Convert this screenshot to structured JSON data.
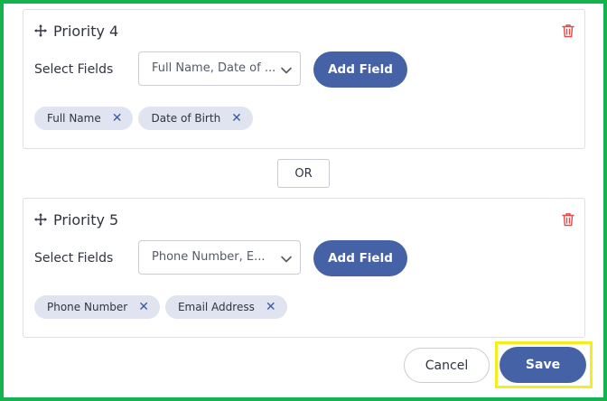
{
  "cards": [
    {
      "title": "Priority 4",
      "select_label": "Select Fields",
      "dropdown_value": "Full Name, Date of ...",
      "add_button": "Add Field",
      "chips": [
        "Full Name",
        "Date of Birth"
      ]
    },
    {
      "title": "Priority 5",
      "select_label": "Select Fields",
      "dropdown_value": "Phone Number, E...",
      "add_button": "Add Field",
      "chips": [
        "Phone Number",
        "Email Address"
      ]
    }
  ],
  "or_label": "OR",
  "footer": {
    "cancel_label": "Cancel",
    "save_label": "Save"
  },
  "colors": {
    "accent": "#4562a6",
    "chip_bg": "#dfe4f0",
    "delete": "#e04a4a",
    "frame": "#14b350",
    "highlight": "#f4ee1d"
  },
  "icons": {
    "drag": "move-icon",
    "delete": "trash-icon",
    "dropdown": "chevron-down-icon",
    "remove": "close-icon"
  }
}
